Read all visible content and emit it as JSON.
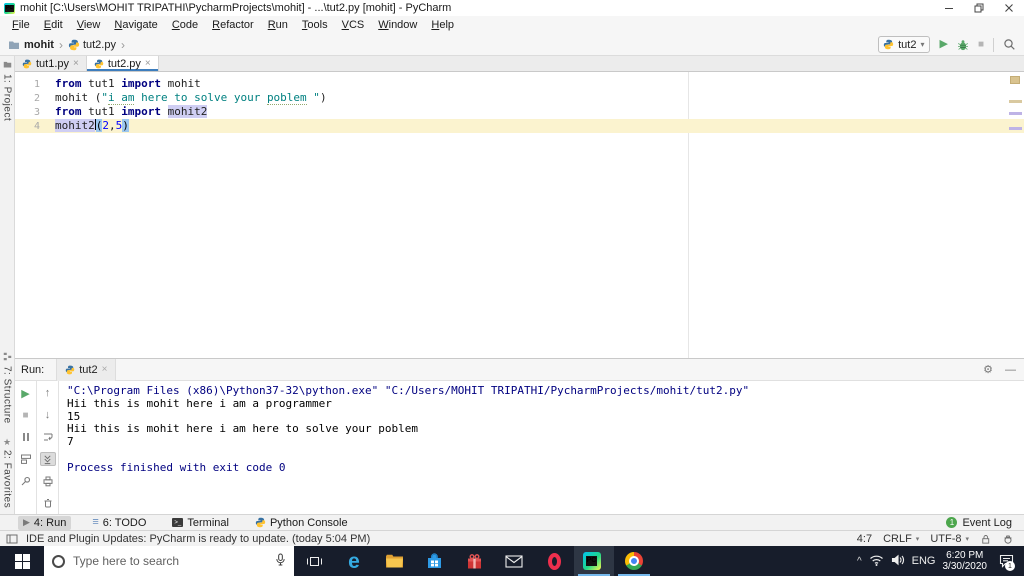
{
  "window": {
    "title": "mohit [C:\\Users\\MOHIT TRIPATHI\\PycharmProjects\\mohit] - ...\\tut2.py [mohit] - PyCharm",
    "logo": "PC"
  },
  "menu": {
    "items": [
      "File",
      "Edit",
      "View",
      "Navigate",
      "Code",
      "Refactor",
      "Run",
      "Tools",
      "VCS",
      "Window",
      "Help"
    ]
  },
  "toolbar": {
    "breadcrumb": {
      "project": "mohit",
      "file": "tut2.py"
    },
    "run_config": "tut2"
  },
  "left_stripe": {
    "project": "1: Project",
    "structure": "7: Structure",
    "favorites": "2: Favorites"
  },
  "tabs": [
    {
      "label": "tut1.py"
    },
    {
      "label": "tut2.py"
    }
  ],
  "editor": {
    "line_numbers": [
      "1",
      "2",
      "3",
      "4"
    ],
    "lines": {
      "l1": {
        "kw1": "from",
        "mid": " tut1 ",
        "kw2": "import",
        "rest": " mohit"
      },
      "l2": {
        "pre": "mohit (",
        "q1": "\"",
        "typo1": "i am",
        "s1": " here to solve your ",
        "typo2": "poblem",
        "s2": " \"",
        "post": ")"
      },
      "l3": {
        "kw1": "from",
        "mid": " tut1 ",
        "kw2": "import",
        "sp": " ",
        "hl": "mohit2"
      },
      "l4": {
        "hl": "mohit2",
        "b1": "(",
        "n1": "2",
        "comma": ",",
        "n2": "5",
        "b2": ")"
      }
    }
  },
  "run_panel": {
    "label": "Run:",
    "tab": "tut2"
  },
  "console": {
    "lines": [
      {
        "text": "\"C:\\Program Files (x86)\\Python37-32\\python.exe\" \"C:/Users/MOHIT TRIPATHI/PycharmProjects/mohit/tut2.py\""
      },
      {
        "text": "Hii this is mohit here i am a programmer"
      },
      {
        "text": "15"
      },
      {
        "text": "Hii this is mohit here i am here to solve your poblem"
      },
      {
        "text": "7"
      },
      {
        "text": ""
      },
      {
        "text": "Process finished with exit code 0"
      }
    ]
  },
  "tool_window_bar": {
    "run": "4: Run",
    "todo": "6: TODO",
    "terminal": "Terminal",
    "python_console": "Python Console",
    "event_log": "Event Log",
    "event_badge": "1"
  },
  "status_bar": {
    "message": "IDE and Plugin Updates: PyCharm is ready to update. (today 5:04 PM)",
    "caret_position": "4:7",
    "line_separator": "CRLF",
    "encoding": "UTF-8"
  },
  "taskbar": {
    "search_placeholder": "Type here to search",
    "language": "ENG",
    "time": "6:20 PM",
    "date": "3/30/2020",
    "notification_count": "1",
    "edge_letter": "e"
  },
  "icons": {
    "play": "▶",
    "stop": "■",
    "gear": "⚙",
    "minus": "—",
    "chevron_down": "▾",
    "chevron_right": "›",
    "close": "×",
    "up_arrow": "↑",
    "down_arrow": "↓",
    "todo_list": "≡",
    "star": "★",
    "tray_chevron": "^"
  },
  "colors": {
    "accent_tab_underline": "#3d7dbd",
    "keyword": "#000080",
    "string": "#008080",
    "number": "#0000ff",
    "current_line": "#fbf3cf",
    "run_green": "#59a869",
    "event_log_green": "#4ca64c",
    "taskbar_bg": "#171d2b",
    "taskbar_underline": "#76b9ed"
  }
}
